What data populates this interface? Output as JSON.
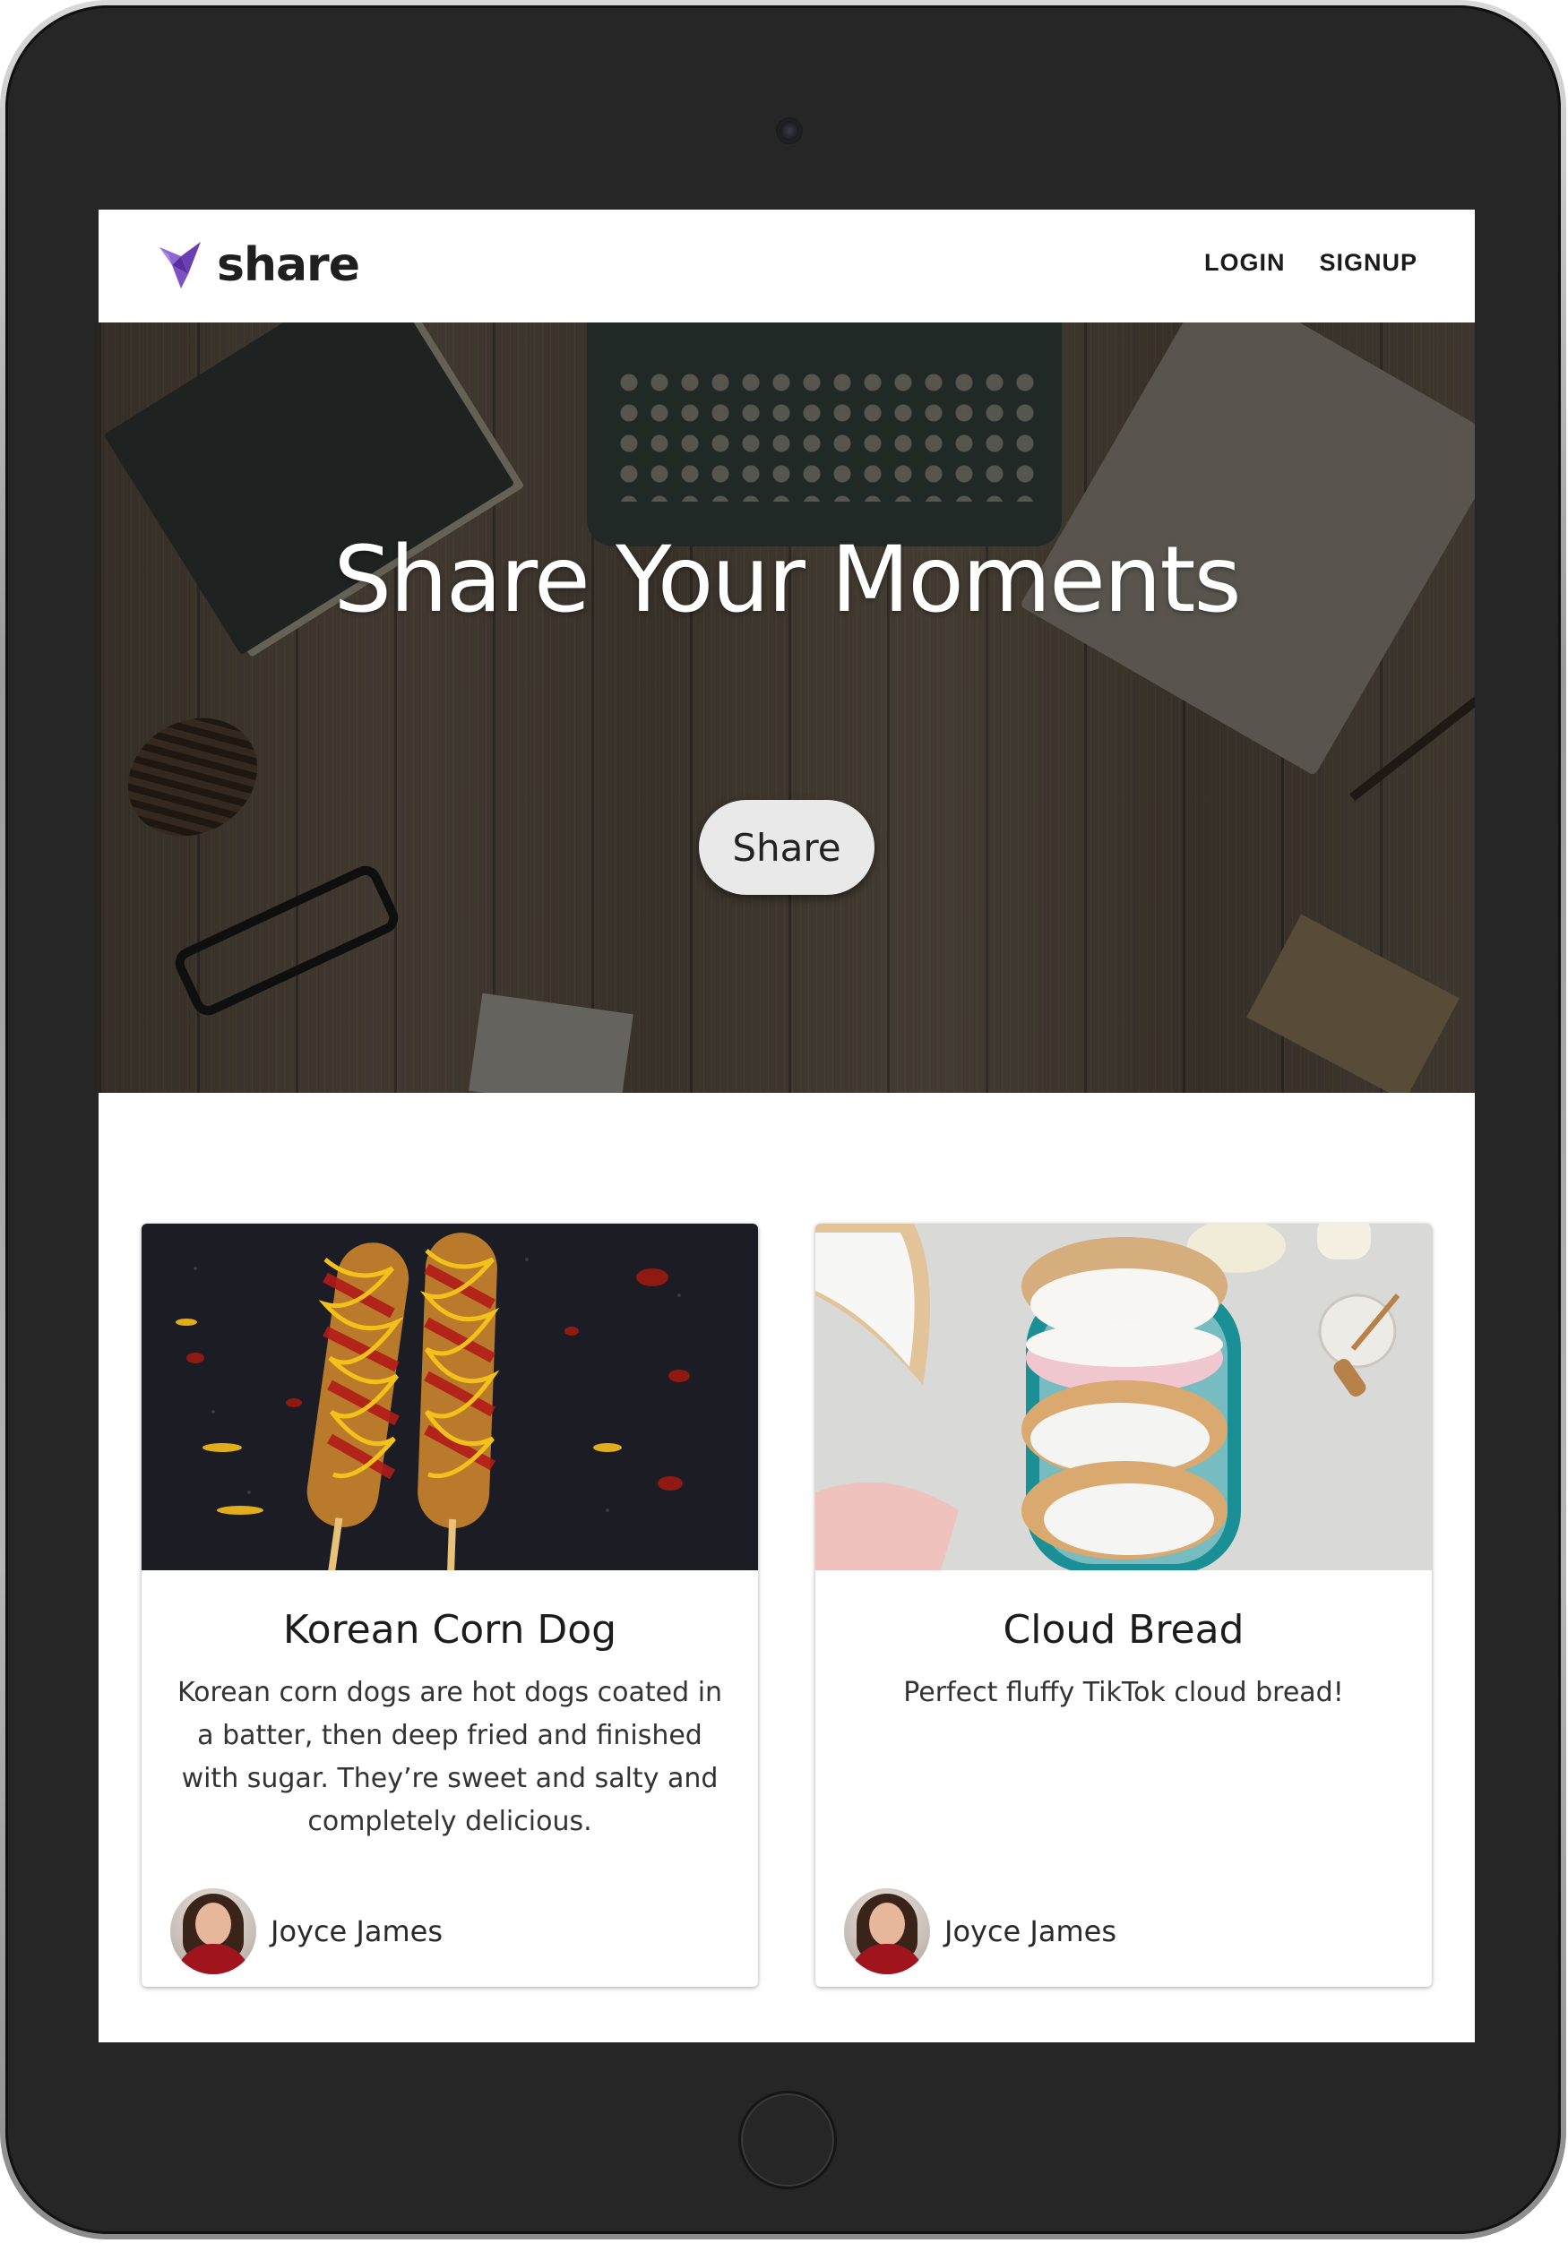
{
  "brand": {
    "name": "share",
    "logo_color": "#6a3fb1"
  },
  "nav": {
    "login_label": "LOGIN",
    "signup_label": "SIGNUP"
  },
  "hero": {
    "title": "Share Your Moments",
    "button_label": "Share"
  },
  "posts": [
    {
      "title": "Korean Corn Dog",
      "description": "Korean corn dogs are hot dogs coated in a batter, then deep fried and finished with sugar. They’re sweet and salty and completely delicious.",
      "author": "Joyce James",
      "image_subject": "corn-dog-photo"
    },
    {
      "title": "Cloud Bread",
      "description": "Perfect fluffy TikTok cloud bread!",
      "author": "Joyce James",
      "image_subject": "cloud-bread-photo"
    }
  ],
  "colors": {
    "accent": "#6a3fb1",
    "header_bg": "#ffffff",
    "button_bg": "#e9e9e9"
  }
}
